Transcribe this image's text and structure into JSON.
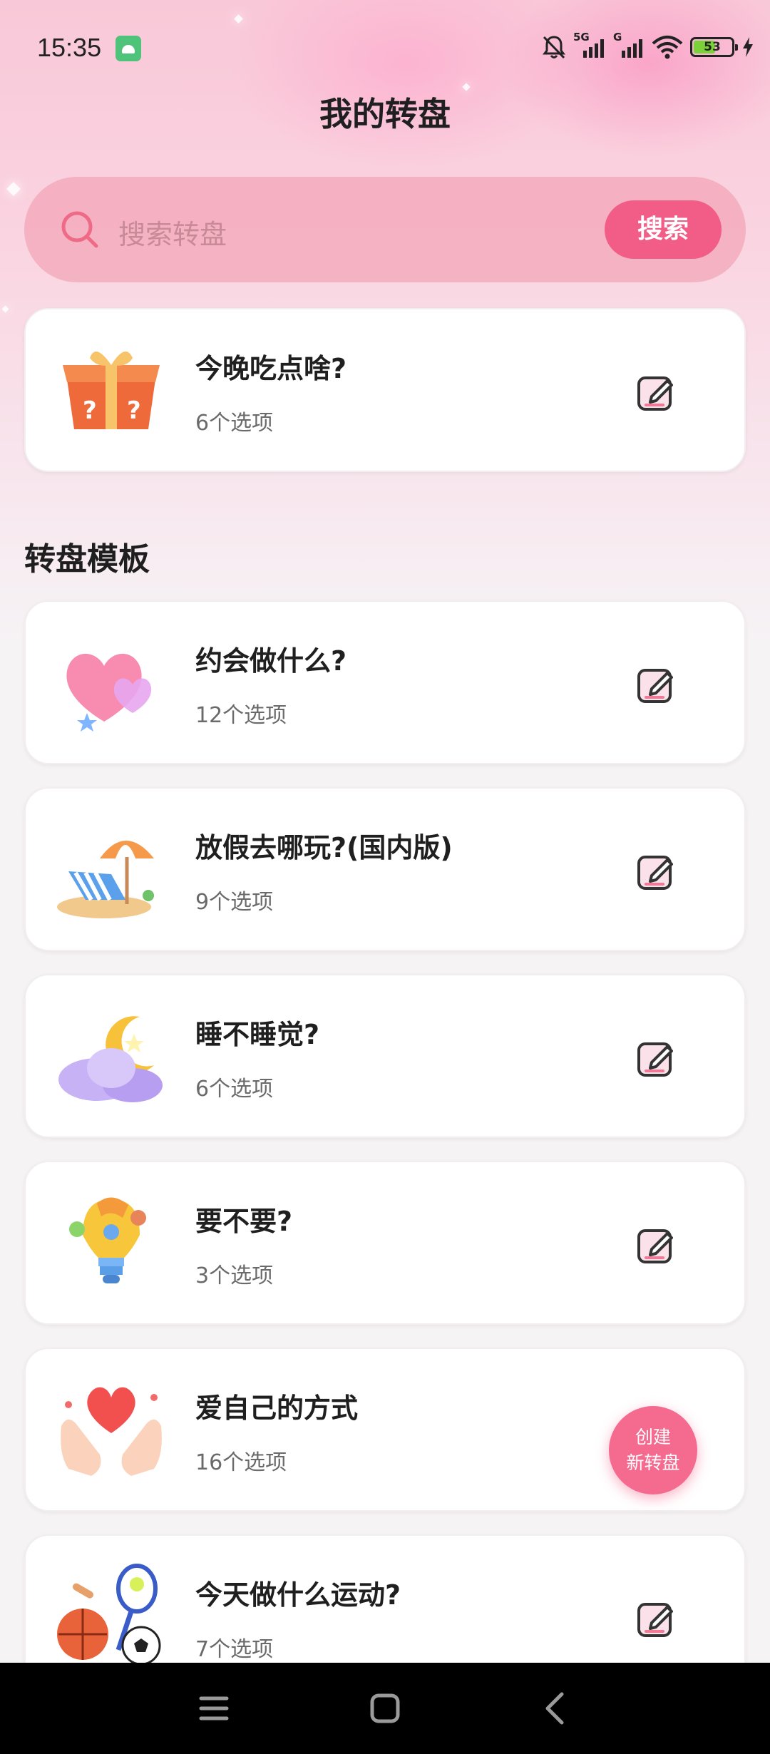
{
  "status": {
    "time": "15:35",
    "signal1": "5G",
    "signal2": "G",
    "battery": "53"
  },
  "page": {
    "title": "我的转盘"
  },
  "search": {
    "placeholder": "搜索转盘",
    "button": "搜索"
  },
  "my_wheels": [
    {
      "title": "今晚吃点啥?",
      "subtitle": "6个选项",
      "icon": "mystery-box-icon"
    }
  ],
  "templates": {
    "heading": "转盘模板",
    "items": [
      {
        "title": "约会做什么?",
        "subtitle": "12个选项",
        "icon": "hearts-icon"
      },
      {
        "title": "放假去哪玩?(国内版)",
        "subtitle": "9个选项",
        "icon": "beach-chair-icon"
      },
      {
        "title": "睡不睡觉?",
        "subtitle": "6个选项",
        "icon": "moon-cloud-icon"
      },
      {
        "title": "要不要?",
        "subtitle": "3个选项",
        "icon": "lightbulb-icon"
      },
      {
        "title": "爱自己的方式",
        "subtitle": "16个选项",
        "icon": "heart-hands-icon"
      },
      {
        "title": "今天做什么运动?",
        "subtitle": "7个选项",
        "icon": "sports-balls-icon"
      }
    ]
  },
  "fab": {
    "line1": "创建",
    "line2": "新转盘"
  },
  "colors": {
    "accent": "#f25d87",
    "text": "#1f1f1f",
    "muted": "#6a6a6a"
  }
}
